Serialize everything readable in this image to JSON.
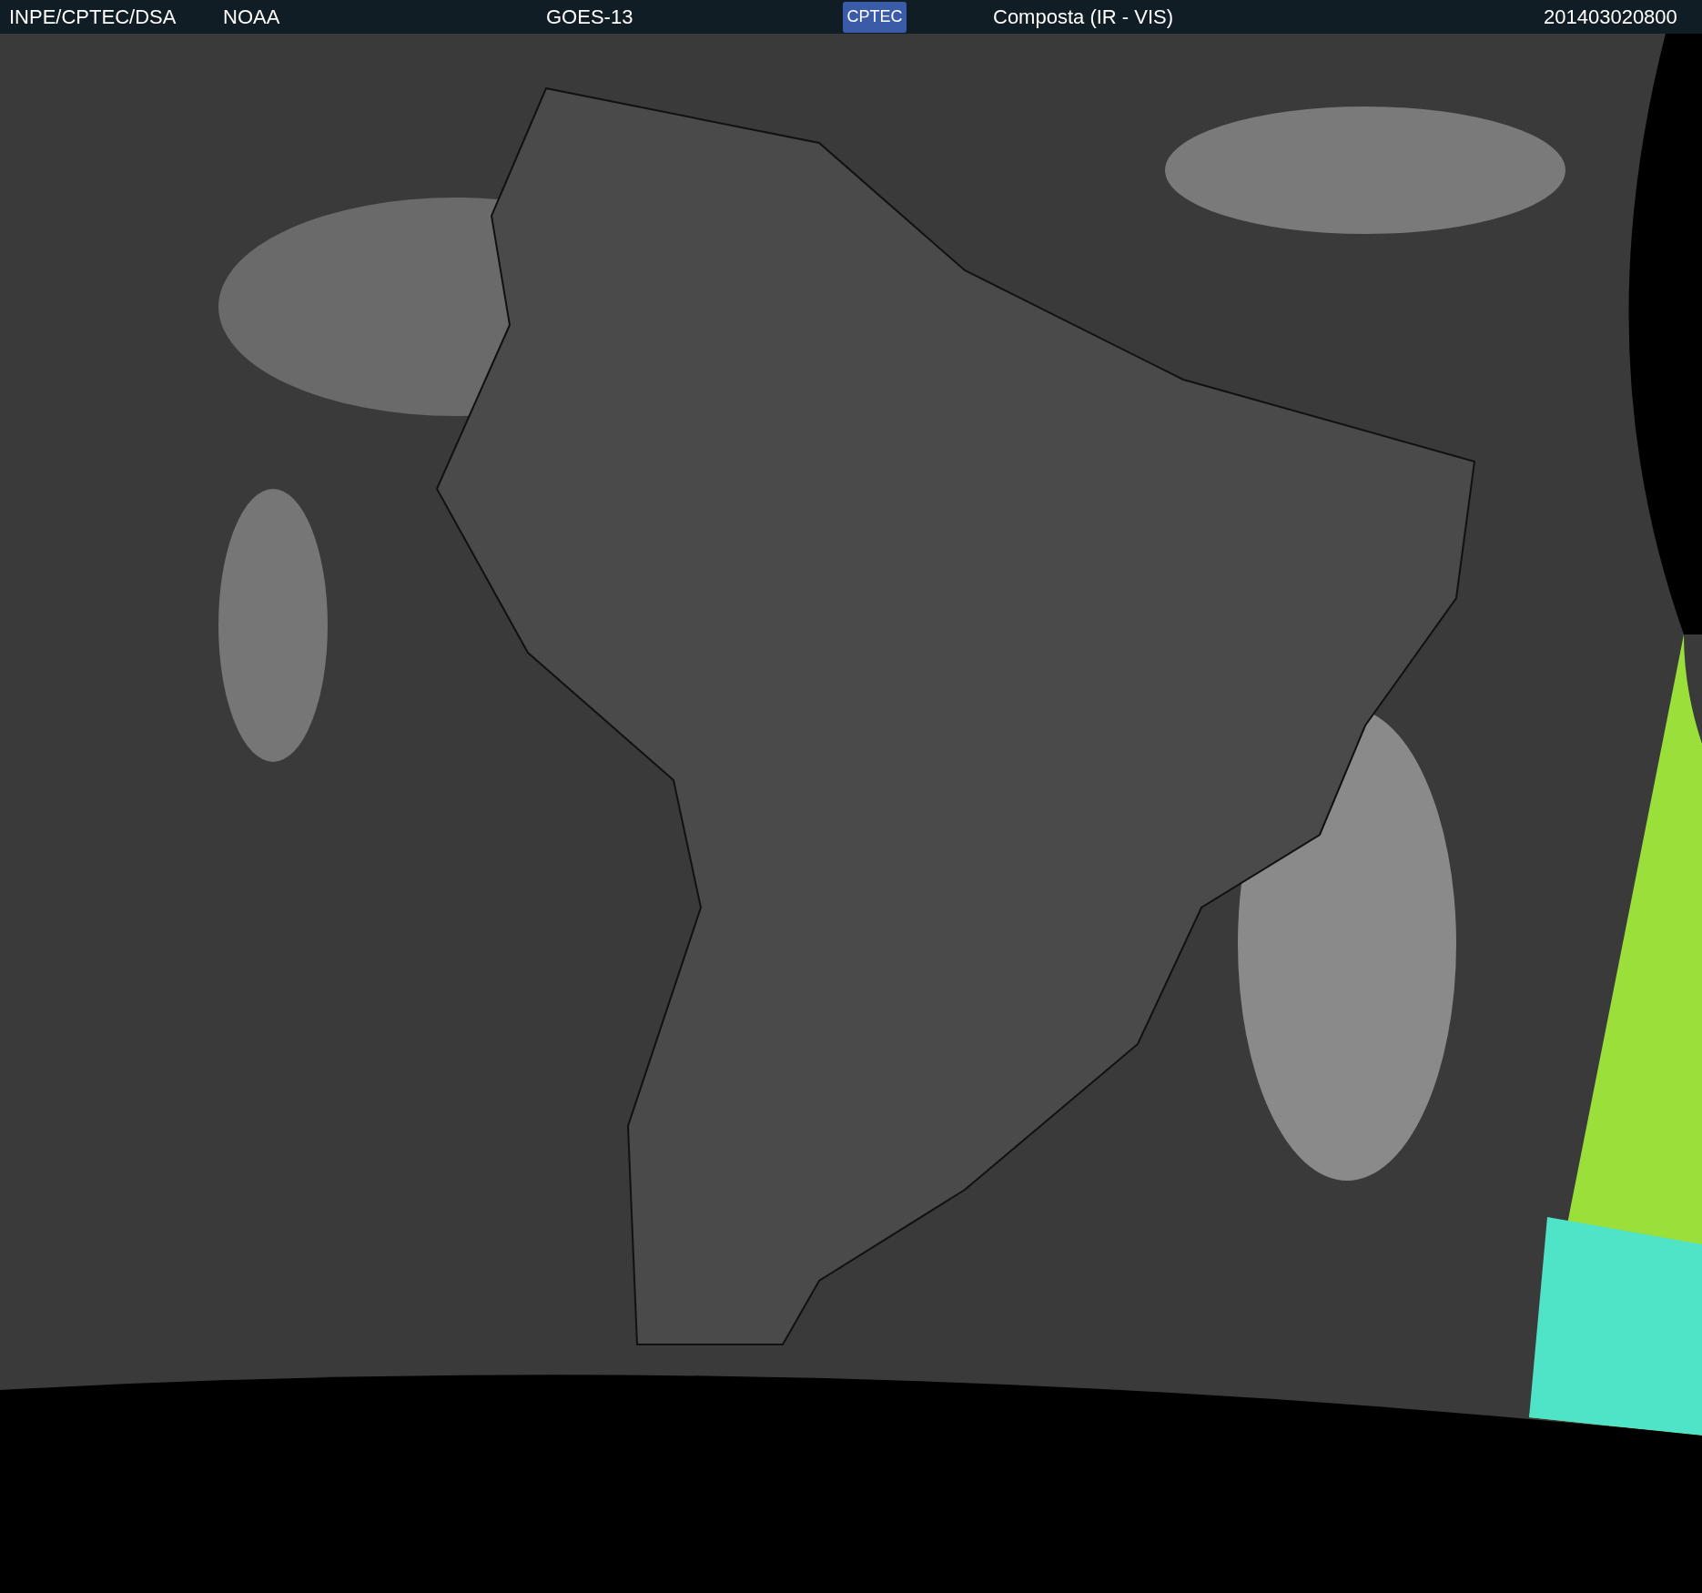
{
  "header": {
    "institution": "INPE/CPTEC/DSA",
    "agency": "NOAA",
    "satellite": "GOES-13",
    "logo": "CPTEC",
    "product": "Composta (IR - VIS)",
    "timestamp": "201403020800"
  }
}
